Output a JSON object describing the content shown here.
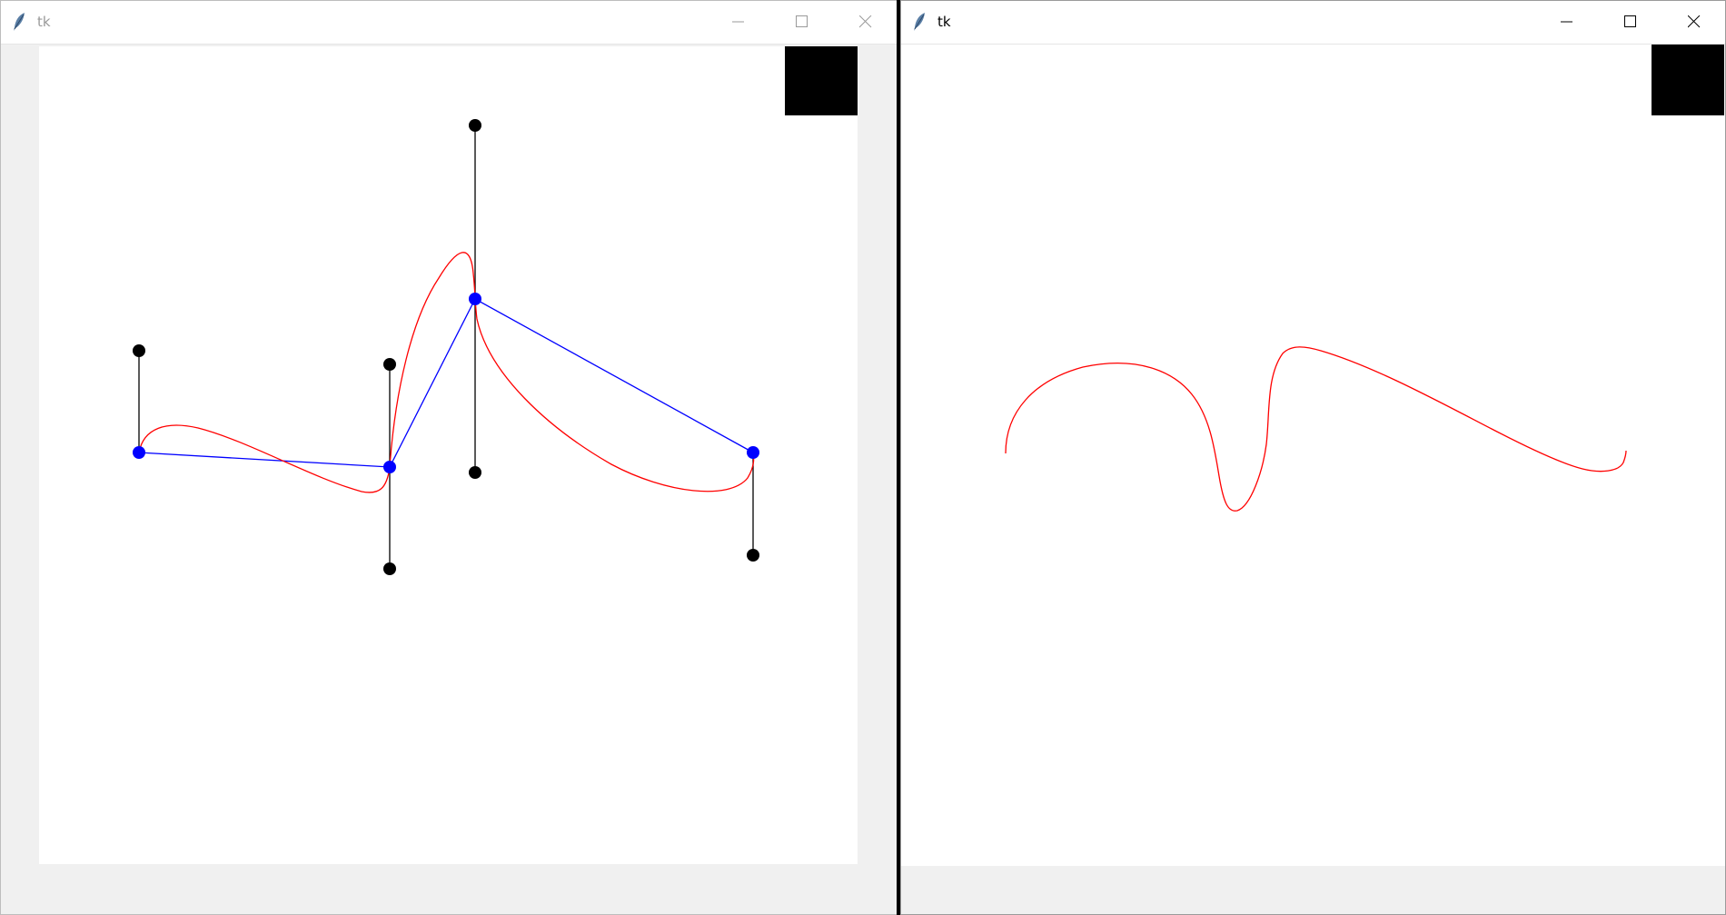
{
  "windows": [
    {
      "title": "tk"
    },
    {
      "title": "tk"
    }
  ],
  "icons": {
    "app": "feather-icon",
    "minimize": "minimize-icon",
    "maximize": "maximize-icon",
    "close": "close-icon"
  },
  "colors": {
    "curve": "#ff0000",
    "control_polygon": "#0000ff",
    "handle_lines": "#000000",
    "handle_points": "#000000",
    "anchor_points": "#0000ff"
  }
}
